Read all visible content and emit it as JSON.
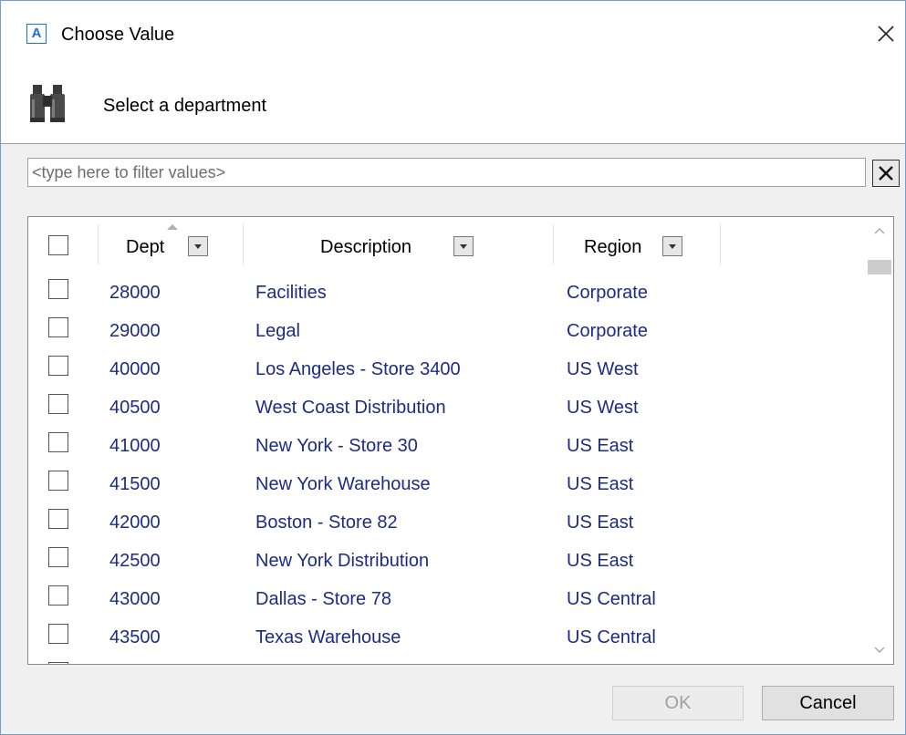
{
  "window": {
    "title": "Choose Value",
    "app_icon_letter": "A",
    "app_icon_name": "app-a-icon",
    "close_icon_name": "close-icon"
  },
  "header": {
    "prompt": "Select a department",
    "icon_name": "binoculars-icon"
  },
  "filter": {
    "value": "",
    "placeholder": "<type here to filter values>",
    "clear_icon_name": "clear-x-icon"
  },
  "grid": {
    "columns": [
      {
        "label": "Dept",
        "sort": "ascending"
      },
      {
        "label": "Description"
      },
      {
        "label": "Region"
      }
    ],
    "rows": [
      {
        "dept": "28000",
        "description": "Facilities",
        "region": "Corporate",
        "checked": false
      },
      {
        "dept": "29000",
        "description": "Legal",
        "region": "Corporate",
        "checked": false
      },
      {
        "dept": "40000",
        "description": "Los Angeles - Store 3400",
        "region": "US West",
        "checked": false
      },
      {
        "dept": "40500",
        "description": "West Coast Distribution",
        "region": "US West",
        "checked": false
      },
      {
        "dept": "41000",
        "description": "New York - Store 30",
        "region": "US East",
        "checked": false
      },
      {
        "dept": "41500",
        "description": "New York Warehouse",
        "region": "US East",
        "checked": false
      },
      {
        "dept": "42000",
        "description": "Boston - Store 82",
        "region": "US East",
        "checked": false
      },
      {
        "dept": "42500",
        "description": "New York Distribution",
        "region": "US East",
        "checked": false
      },
      {
        "dept": "43000",
        "description": "Dallas - Store 78",
        "region": "US Central",
        "checked": false
      },
      {
        "dept": "43500",
        "description": "Texas Warehouse",
        "region": "US Central",
        "checked": false
      }
    ]
  },
  "buttons": {
    "ok": "OK",
    "cancel": "Cancel",
    "ok_enabled": false
  },
  "colors": {
    "link_text": "#1c2b86",
    "window_border": "#6f9fd1",
    "app_icon": "#1f6fd0",
    "disabled_text": "#a0a0a0"
  }
}
